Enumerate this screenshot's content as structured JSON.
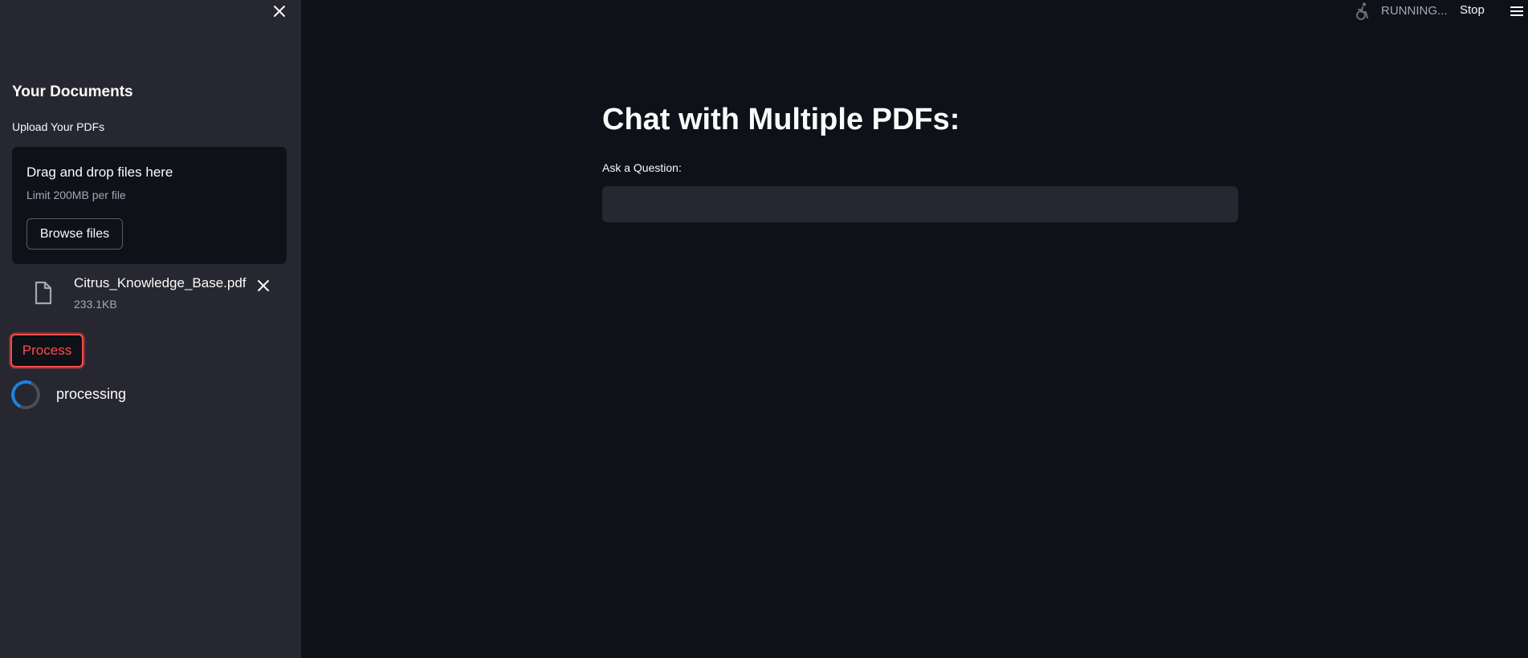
{
  "sidebar": {
    "heading": "Your Documents",
    "upload_label": "Upload Your PDFs",
    "dropzone": {
      "title": "Drag and drop files here",
      "limit": "Limit 200MB per file",
      "browse_label": "Browse files"
    },
    "file": {
      "name": "Citrus_Knowledge_Base.pdf",
      "size": "233.1KB"
    },
    "process_label": "Process",
    "status_text": "processing"
  },
  "header": {
    "status": "RUNNING...",
    "stop_label": "Stop"
  },
  "main": {
    "title": "Chat with Multiple PDFs:",
    "question_label": "Ask a Question:",
    "question_value": ""
  },
  "colors": {
    "sidebar_bg": "#262730",
    "main_bg": "#0e1117",
    "accent": "#ff4b4b",
    "spinner": "#1c83e1"
  },
  "icons": {
    "close": "close-icon",
    "file": "file-icon",
    "remove": "close-icon",
    "running": "running-person-icon",
    "menu": "hamburger-menu-icon"
  }
}
